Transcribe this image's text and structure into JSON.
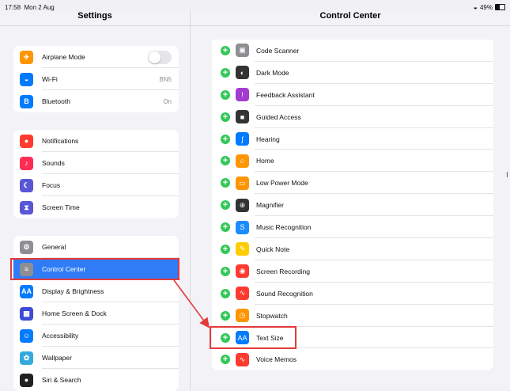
{
  "status_bar": {
    "time": "17:58",
    "date": "Mon 2 Aug",
    "battery": "49%",
    "battery_level": 0.49
  },
  "sidebar": {
    "title": "Settings",
    "groups": [
      [
        {
          "label": "Airplane Mode",
          "icon": "airplane-icon",
          "color": "#ff9500",
          "toggle": false
        },
        {
          "label": "Wi-Fi",
          "value": "BN5",
          "icon": "wifi-icon",
          "color": "#007aff"
        },
        {
          "label": "Bluetooth",
          "value": "On",
          "icon": "bluetooth-icon",
          "color": "#007aff"
        }
      ],
      [
        {
          "label": "Notifications",
          "icon": "notifications-icon",
          "color": "#ff3b30"
        },
        {
          "label": "Sounds",
          "icon": "sounds-icon",
          "color": "#ff2d55"
        },
        {
          "label": "Focus",
          "icon": "moon-icon",
          "color": "#5856d6"
        },
        {
          "label": "Screen Time",
          "icon": "hourglass-icon",
          "color": "#5856d6"
        }
      ],
      [
        {
          "label": "General",
          "icon": "gear-icon",
          "color": "#8e8e93"
        },
        {
          "label": "Control Center",
          "icon": "switches-icon",
          "color": "#8e8e93",
          "selected": true
        },
        {
          "label": "Display & Brightness",
          "icon": "text-aa-icon",
          "color": "#007aff"
        },
        {
          "label": "Home Screen & Dock",
          "icon": "grid-icon",
          "color": "#3b4bd6"
        },
        {
          "label": "Accessibility",
          "icon": "accessibility-icon",
          "color": "#007aff"
        },
        {
          "label": "Wallpaper",
          "icon": "flower-icon",
          "color": "#34aadc"
        },
        {
          "label": "Siri & Search",
          "icon": "siri-icon",
          "color": "#222222"
        }
      ]
    ]
  },
  "main": {
    "title": "Control Center",
    "items": [
      {
        "label": "Code Scanner",
        "icon": "qr-code-icon",
        "color": "#8e8e93"
      },
      {
        "label": "Dark Mode",
        "icon": "dark-mode-icon",
        "color": "#333333"
      },
      {
        "label": "Feedback Assistant",
        "icon": "feedback-icon",
        "color": "#a33bd1"
      },
      {
        "label": "Guided Access",
        "icon": "lock-icon",
        "color": "#333333"
      },
      {
        "label": "Hearing",
        "icon": "ear-icon",
        "color": "#007aff"
      },
      {
        "label": "Home",
        "icon": "home-icon",
        "color": "#ff9500"
      },
      {
        "label": "Low Power Mode",
        "icon": "battery-icon",
        "color": "#ff9500"
      },
      {
        "label": "Magnifier",
        "icon": "magnifier-icon",
        "color": "#333333"
      },
      {
        "label": "Music Recognition",
        "icon": "shazam-icon",
        "color": "#1a8cff"
      },
      {
        "label": "Quick Note",
        "icon": "note-icon",
        "color": "#ffcc00"
      },
      {
        "label": "Screen Recording",
        "icon": "record-icon",
        "color": "#ff3b30"
      },
      {
        "label": "Sound Recognition",
        "icon": "sound-recognition-icon",
        "color": "#ff3b30"
      },
      {
        "label": "Stopwatch",
        "icon": "stopwatch-icon",
        "color": "#ff9500"
      },
      {
        "label": "Text Size",
        "icon": "text-size-icon",
        "color": "#007aff"
      },
      {
        "label": "Voice Memos",
        "icon": "voice-memo-icon",
        "color": "#ff3b30"
      }
    ]
  },
  "annotation_color": "#e33a3a"
}
